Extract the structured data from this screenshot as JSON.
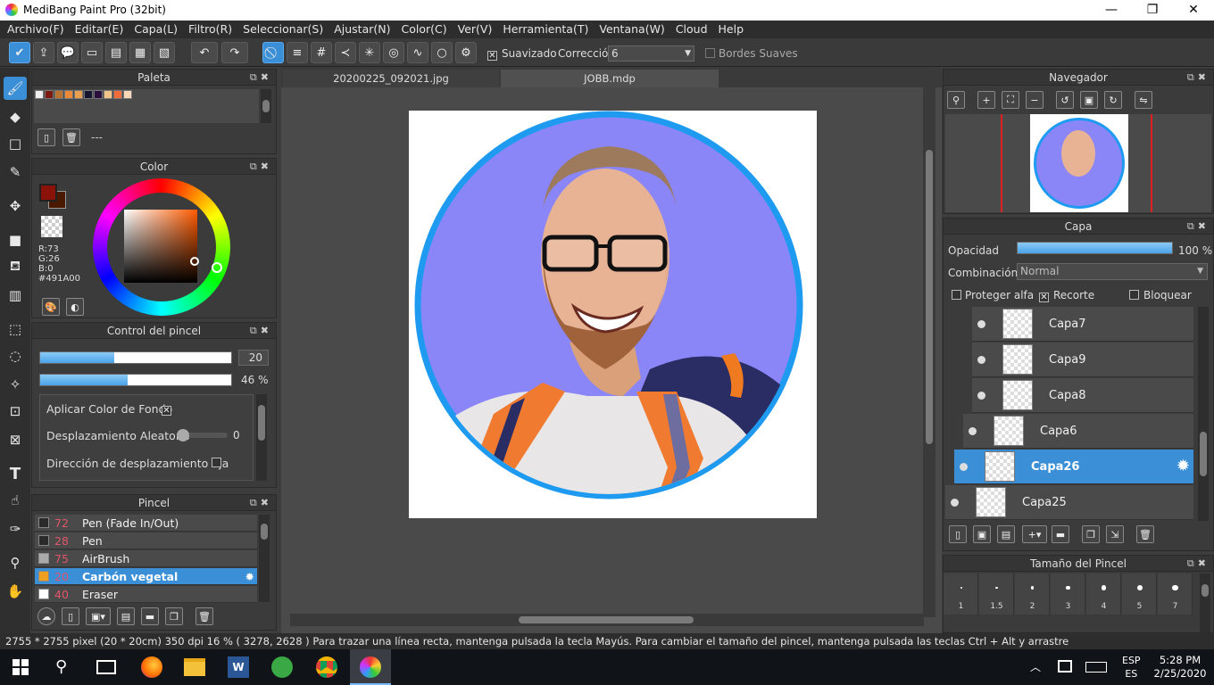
{
  "window": {
    "title": "MediBang Paint Pro (32bit)",
    "minimize": "—",
    "maximize": "❐",
    "close": "✕"
  },
  "menu": [
    "Archivo(F)",
    "Editar(E)",
    "Capa(L)",
    "Filtro(R)",
    "Seleccionar(S)",
    "Ajustar(N)",
    "Color(C)",
    "Ver(V)",
    "Herramienta(T)",
    "Ventana(W)",
    "Cloud",
    "Help"
  ],
  "toolbar": {
    "smoothing_label": "Suavizado",
    "correction_label": "Corrección",
    "correction_value": "6",
    "soft_edges_label": "Bordes Suaves"
  },
  "palette": {
    "title": "Paleta",
    "swatches": [
      "#eeeeee",
      "#7a1a10",
      "#b87333",
      "#ea8a38",
      "#e8a050",
      "#151530",
      "#2a1040",
      "#f3c38a",
      "#f26b3a",
      "#f6d8b8"
    ],
    "empty_label": "---"
  },
  "color": {
    "title": "Color",
    "fg": "#8a1208",
    "bg": "#491A00",
    "r": "R:73",
    "g": "G:26",
    "b": "B:0",
    "hex": "#491A00"
  },
  "brush_control": {
    "title": "Control del pincel",
    "size_value": "20",
    "opacity_value": "46 %",
    "size_fraction": 0.39,
    "opacity_fraction": 0.46,
    "apply_bg": "Aplicar Color de Fondo",
    "random_shift": "Desplazamiento Aleatorio",
    "random_shift_value": "0",
    "fixed_shift": "Dirección de desplazamiento fija"
  },
  "brush_list": {
    "title": "Pincel",
    "items": [
      {
        "num": "72",
        "name": "Pen (Fade In/Out)",
        "color": "#2a2a2a"
      },
      {
        "num": "28",
        "name": "Pen",
        "color": "#2a2a2a"
      },
      {
        "num": "75",
        "name": "AirBrush",
        "color": "#aaaaaa"
      },
      {
        "num": "20",
        "name": "Carbón vegetal",
        "color": "#f0a020",
        "selected": true
      },
      {
        "num": "40",
        "name": "Eraser",
        "color": "#ffffff"
      }
    ]
  },
  "tabs": [
    "20200225_092021.jpg",
    "JOBB.mdp"
  ],
  "navigator": {
    "title": "Navegador"
  },
  "layers": {
    "title": "Capa",
    "opacity_label": "Opacidad",
    "opacity_value": "100 %",
    "opacity_fraction": 1.0,
    "blend_label": "Combinación",
    "blend_value": "Normal",
    "protect_alpha": "Proteger alfa",
    "clipping": "Recorte",
    "lock": "Bloquear",
    "items": [
      {
        "name": "Capa7"
      },
      {
        "name": "Capa9"
      },
      {
        "name": "Capa8"
      },
      {
        "name": "Capa6"
      },
      {
        "name": "Capa26",
        "selected": true
      },
      {
        "name": "Capa25"
      }
    ]
  },
  "brush_size": {
    "title": "Tamaño del Pincel",
    "sizes": [
      "1",
      "1.5",
      "2",
      "3",
      "4",
      "5",
      "7"
    ]
  },
  "status": {
    "text": "2755 * 2755 pixel  (20 * 20cm)  350 dpi  16 %  ( 3278, 2628 )  Para trazar una línea recta, mantenga pulsada la tecla Mayús. Para cambiar el tamaño del pincel, mantenga pulsada las teclas Ctrl + Alt y arrastre"
  },
  "taskbar": {
    "lang1": "ESP",
    "lang2": "ES",
    "time": "5:28 PM",
    "date": "2/25/2020"
  }
}
